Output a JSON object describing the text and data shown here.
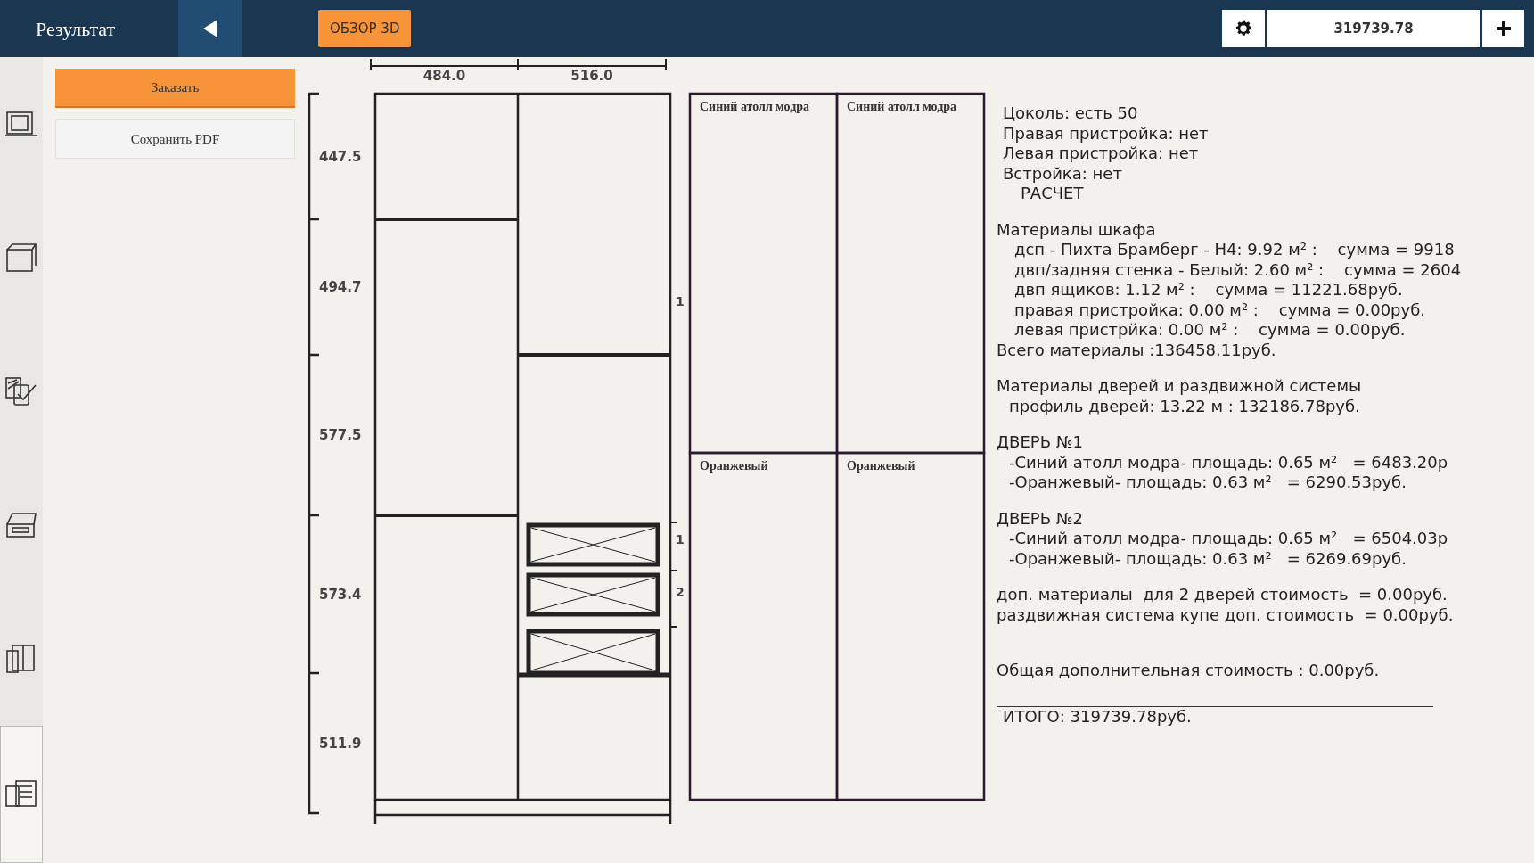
{
  "header": {
    "title": "Результат",
    "view_button": "ОБЗОР 3D",
    "total": "319739.78"
  },
  "rail": [
    {
      "selected": false
    },
    {
      "selected": false
    },
    {
      "selected": false
    },
    {
      "selected": false
    },
    {
      "selected": false
    },
    {
      "selected": true
    }
  ],
  "actions": [
    {
      "label": "Заказать",
      "kind": "primary"
    },
    {
      "label": "Сохранить PDF",
      "kind": "secondary"
    }
  ],
  "cabinet": {
    "column_widths": [
      "484.0",
      "516.0"
    ],
    "section_heights": [
      "447.5",
      "494.7",
      "577.5",
      "573.4",
      "511.9"
    ],
    "side_marks": [
      "1",
      "1",
      "2"
    ]
  },
  "doors": [
    {
      "panels": [
        "Синий атолл модра",
        "Оранжевый"
      ]
    },
    {
      "panels": [
        "Синий атолл модра",
        "Оранжевый"
      ]
    }
  ],
  "summary": [
    [
      {
        "kind": "top",
        "text": "Цоколь: есть 50"
      },
      {
        "kind": "top",
        "text": "Правая пристройка: нет"
      },
      {
        "kind": "top",
        "text": "Левая пристройка: нет"
      },
      {
        "kind": "top",
        "text": "Встройка: нет"
      },
      {
        "kind": "title",
        "text": "РАСЧЕТ"
      }
    ],
    [
      {
        "kind": "head",
        "text": "Материалы шкафа"
      },
      {
        "kind": "item",
        "text": "дсп - Пихта Брамберг - Н4: 9.92 м² :    сумма = 9918"
      },
      {
        "kind": "item",
        "text": "двп/задняя стенка - Белый: 2.60 м² :    сумма = 2604"
      },
      {
        "kind": "item",
        "text": "двп ящиков: 1.12 м² :    сумма = 11221.68руб."
      },
      {
        "kind": "item",
        "text": "правая пристройка: 0.00 м² :    сумма = 0.00руб."
      },
      {
        "kind": "item",
        "text": "левая пристрйка: 0.00 м² :    сумма = 0.00руб."
      },
      {
        "kind": "head",
        "text": "Всего материалы :136458.11руб."
      }
    ],
    [
      {
        "kind": "head",
        "text": "Материалы дверей и раздвижной системы"
      },
      {
        "kind": "sub",
        "text": "профиль дверей: 13.22 м : 132186.78руб."
      }
    ],
    [
      {
        "kind": "head",
        "text": "ДВЕРЬ №1"
      },
      {
        "kind": "sub",
        "text": "-Синий атолл модра- площадь: 0.65 м²   = 6483.20р"
      },
      {
        "kind": "sub",
        "text": "-Оранжевый- площадь: 0.63 м²   = 6290.53руб."
      }
    ],
    [
      {
        "kind": "head",
        "text": "ДВЕРЬ №2"
      },
      {
        "kind": "sub",
        "text": "-Синий атолл модра- площадь: 0.65 м²   = 6504.03р"
      },
      {
        "kind": "sub",
        "text": "-Оранжевый- площадь: 0.63 м²   = 6269.69руб."
      }
    ],
    [
      {
        "kind": "head",
        "text": "доп. материалы  для 2 дверей стоимость  = 0.00руб."
      },
      {
        "kind": "head",
        "text": "раздвижная система купе доп. стоимость  = 0.00руб."
      }
    ],
    [
      {
        "kind": "head",
        "text": "Общая дополнительная стоимость : 0.00руб."
      }
    ]
  ],
  "grand_total": "ИТОГО: 319739.78руб."
}
